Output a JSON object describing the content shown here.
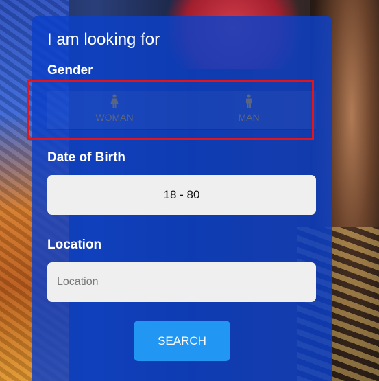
{
  "search_form": {
    "title": "I am looking for",
    "gender": {
      "label": "Gender",
      "options": [
        {
          "label": "WOMAN",
          "icon": "female-person-icon"
        },
        {
          "label": "MAN",
          "icon": "male-person-icon"
        }
      ]
    },
    "date_of_birth": {
      "label": "Date of Birth",
      "value": "18 - 80"
    },
    "location": {
      "label": "Location",
      "placeholder": "Location",
      "value": ""
    },
    "search_button": "SEARCH"
  },
  "colors": {
    "panel": "#0c40c8",
    "button": "#2196f3",
    "highlight": "#e0161c",
    "field": "#efefef"
  }
}
